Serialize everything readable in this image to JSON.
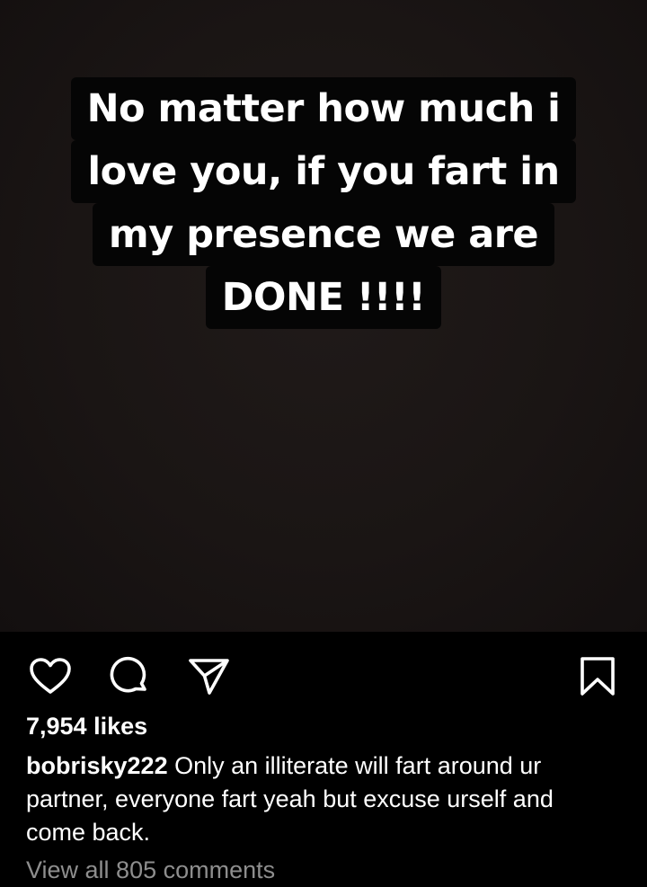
{
  "post": {
    "story_lines": [
      "No matter how much i",
      "love you, if you fart in",
      "my presence we are",
      "DONE !!!!"
    ]
  },
  "actions": {
    "like_icon": "heart-icon",
    "comment_icon": "comment-icon",
    "share_icon": "paper-plane-icon",
    "save_icon": "bookmark-icon"
  },
  "likes_text": "7,954 likes",
  "caption": {
    "username": "bobrisky222",
    "text": " Only an illiterate will fart around ur partner, everyone fart yeah but excuse urself and come back."
  },
  "view_comments": "View all 805 comments"
}
